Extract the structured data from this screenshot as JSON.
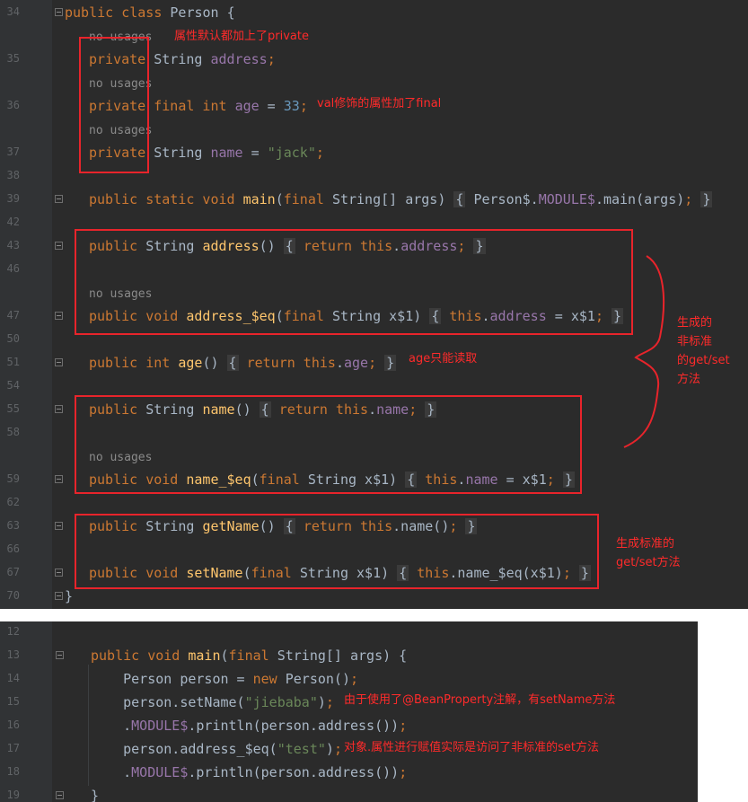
{
  "panel1": {
    "rows": [
      {
        "ln": "34",
        "fold": true,
        "parts": [
          {
            "t": "public class ",
            "c": "kw"
          },
          {
            "t": "Person {",
            "c": ""
          }
        ]
      },
      {
        "ln": "",
        "hint": "no usages"
      },
      {
        "ln": "35",
        "parts": [
          {
            "t": "private ",
            "c": "kw"
          },
          {
            "t": "String ",
            "c": ""
          },
          {
            "t": "address",
            "c": "fld"
          },
          {
            "t": ";",
            "c": "kw"
          }
        ]
      },
      {
        "ln": "",
        "hint": "no usages"
      },
      {
        "ln": "36",
        "parts": [
          {
            "t": "private final int ",
            "c": "kw"
          },
          {
            "t": "age",
            "c": "fld"
          },
          {
            "t": " = ",
            "c": ""
          },
          {
            "t": "33",
            "c": "num"
          },
          {
            "t": ";",
            "c": "kw"
          }
        ]
      },
      {
        "ln": "",
        "hint": "no usages"
      },
      {
        "ln": "37",
        "parts": [
          {
            "t": "private ",
            "c": "kw"
          },
          {
            "t": "String ",
            "c": ""
          },
          {
            "t": "name",
            "c": "fld"
          },
          {
            "t": " = ",
            "c": ""
          },
          {
            "t": "\"jack\"",
            "c": "str"
          },
          {
            "t": ";",
            "c": "kw"
          }
        ]
      },
      {
        "ln": "38",
        "parts": []
      },
      {
        "ln": "39",
        "fold": true,
        "parts": [
          {
            "t": "public static void ",
            "c": "kw"
          },
          {
            "t": "main",
            "c": "fn"
          },
          {
            "t": "(",
            "c": ""
          },
          {
            "t": "final ",
            "c": "kw"
          },
          {
            "t": "String[] args) ",
            "c": ""
          },
          {
            "t": "{",
            "c": "brace"
          },
          {
            "t": " Person$.",
            "c": ""
          },
          {
            "t": "MODULE$",
            "c": "fld"
          },
          {
            "t": ".main(args)",
            "c": ""
          },
          {
            "t": ";",
            "c": "kw"
          },
          {
            "t": " ",
            "c": ""
          },
          {
            "t": "}",
            "c": "brace"
          }
        ]
      },
      {
        "ln": "42",
        "parts": []
      },
      {
        "ln": "43",
        "fold": true,
        "parts": [
          {
            "t": "public ",
            "c": "kw"
          },
          {
            "t": "String ",
            "c": ""
          },
          {
            "t": "address",
            "c": "fn"
          },
          {
            "t": "() ",
            "c": ""
          },
          {
            "t": "{",
            "c": "brace"
          },
          {
            "t": " ",
            "c": ""
          },
          {
            "t": "return this",
            "c": "kw"
          },
          {
            "t": ".",
            "c": ""
          },
          {
            "t": "address",
            "c": "fld"
          },
          {
            "t": ";",
            "c": "kw"
          },
          {
            "t": " ",
            "c": ""
          },
          {
            "t": "}",
            "c": "brace"
          }
        ]
      },
      {
        "ln": "46",
        "parts": []
      },
      {
        "ln": "",
        "hint": "no usages"
      },
      {
        "ln": "47",
        "fold": true,
        "parts": [
          {
            "t": "public void ",
            "c": "kw"
          },
          {
            "t": "address_$eq",
            "c": "fn"
          },
          {
            "t": "(",
            "c": ""
          },
          {
            "t": "final ",
            "c": "kw"
          },
          {
            "t": "String x$1) ",
            "c": ""
          },
          {
            "t": "{",
            "c": "brace"
          },
          {
            "t": " ",
            "c": ""
          },
          {
            "t": "this",
            "c": "kw"
          },
          {
            "t": ".",
            "c": ""
          },
          {
            "t": "address",
            "c": "fld"
          },
          {
            "t": " = x$1",
            "c": ""
          },
          {
            "t": ";",
            "c": "kw"
          },
          {
            "t": " ",
            "c": ""
          },
          {
            "t": "}",
            "c": "brace"
          }
        ]
      },
      {
        "ln": "50",
        "parts": []
      },
      {
        "ln": "51",
        "fold": true,
        "parts": [
          {
            "t": "public int ",
            "c": "kw"
          },
          {
            "t": "age",
            "c": "fn"
          },
          {
            "t": "() ",
            "c": ""
          },
          {
            "t": "{",
            "c": "brace"
          },
          {
            "t": " ",
            "c": ""
          },
          {
            "t": "return this",
            "c": "kw"
          },
          {
            "t": ".",
            "c": ""
          },
          {
            "t": "age",
            "c": "fld"
          },
          {
            "t": ";",
            "c": "kw"
          },
          {
            "t": " ",
            "c": ""
          },
          {
            "t": "}",
            "c": "brace"
          }
        ]
      },
      {
        "ln": "54",
        "parts": []
      },
      {
        "ln": "55",
        "fold": true,
        "parts": [
          {
            "t": "public ",
            "c": "kw"
          },
          {
            "t": "String ",
            "c": ""
          },
          {
            "t": "name",
            "c": "fn"
          },
          {
            "t": "() ",
            "c": ""
          },
          {
            "t": "{",
            "c": "brace"
          },
          {
            "t": " ",
            "c": ""
          },
          {
            "t": "return this",
            "c": "kw"
          },
          {
            "t": ".",
            "c": ""
          },
          {
            "t": "name",
            "c": "fld"
          },
          {
            "t": ";",
            "c": "kw"
          },
          {
            "t": " ",
            "c": ""
          },
          {
            "t": "}",
            "c": "brace"
          }
        ]
      },
      {
        "ln": "58",
        "parts": []
      },
      {
        "ln": "",
        "hint": "no usages"
      },
      {
        "ln": "59",
        "fold": true,
        "parts": [
          {
            "t": "public void ",
            "c": "kw"
          },
          {
            "t": "name_$eq",
            "c": "fn"
          },
          {
            "t": "(",
            "c": ""
          },
          {
            "t": "final ",
            "c": "kw"
          },
          {
            "t": "String x$1) ",
            "c": ""
          },
          {
            "t": "{",
            "c": "brace"
          },
          {
            "t": " ",
            "c": ""
          },
          {
            "t": "this",
            "c": "kw"
          },
          {
            "t": ".",
            "c": ""
          },
          {
            "t": "name",
            "c": "fld"
          },
          {
            "t": " = x$1",
            "c": ""
          },
          {
            "t": ";",
            "c": "kw"
          },
          {
            "t": " ",
            "c": ""
          },
          {
            "t": "}",
            "c": "brace"
          }
        ]
      },
      {
        "ln": "62",
        "parts": []
      },
      {
        "ln": "63",
        "fold": true,
        "parts": [
          {
            "t": "public ",
            "c": "kw"
          },
          {
            "t": "String ",
            "c": ""
          },
          {
            "t": "getName",
            "c": "fn"
          },
          {
            "t": "() ",
            "c": ""
          },
          {
            "t": "{",
            "c": "brace"
          },
          {
            "t": " ",
            "c": ""
          },
          {
            "t": "return this",
            "c": "kw"
          },
          {
            "t": ".name()",
            "c": ""
          },
          {
            "t": ";",
            "c": "kw"
          },
          {
            "t": " ",
            "c": ""
          },
          {
            "t": "}",
            "c": "brace"
          }
        ]
      },
      {
        "ln": "66",
        "parts": []
      },
      {
        "ln": "67",
        "fold": true,
        "parts": [
          {
            "t": "public void ",
            "c": "kw"
          },
          {
            "t": "setName",
            "c": "fn"
          },
          {
            "t": "(",
            "c": ""
          },
          {
            "t": "final ",
            "c": "kw"
          },
          {
            "t": "String x$1) ",
            "c": ""
          },
          {
            "t": "{",
            "c": "brace"
          },
          {
            "t": " ",
            "c": ""
          },
          {
            "t": "this",
            "c": "kw"
          },
          {
            "t": ".name_$eq(x$1)",
            "c": ""
          },
          {
            "t": ";",
            "c": "kw"
          },
          {
            "t": " ",
            "c": ""
          },
          {
            "t": "}",
            "c": "brace"
          }
        ]
      },
      {
        "ln": "70",
        "fold": true,
        "parts": [
          {
            "t": "}",
            "c": ""
          }
        ]
      }
    ],
    "annotations": {
      "private_default": "属性默认都加上了private",
      "val_final": "val修饰的属性加了final",
      "age_readonly": "age只能读取",
      "nonstandard": "生成的\n非标准\n的get/set\n方法",
      "standard": "生成标准的\nget/set方法"
    }
  },
  "panel2": {
    "rows": [
      {
        "ln": "12",
        "parts": []
      },
      {
        "ln": "13",
        "fold": true,
        "parts": [
          {
            "t": "public void ",
            "c": "kw"
          },
          {
            "t": "main",
            "c": "fn"
          },
          {
            "t": "(",
            "c": ""
          },
          {
            "t": "final ",
            "c": "kw"
          },
          {
            "t": "String[] args) {",
            "c": ""
          }
        ]
      },
      {
        "ln": "14",
        "parts": [
          {
            "t": "    Person person = ",
            "c": ""
          },
          {
            "t": "new ",
            "c": "kw"
          },
          {
            "t": "Person()",
            "c": ""
          },
          {
            "t": ";",
            "c": "kw"
          }
        ]
      },
      {
        "ln": "15",
        "parts": [
          {
            "t": "    person.setName(",
            "c": ""
          },
          {
            "t": "\"jiebaba\"",
            "c": "str"
          },
          {
            "t": ")",
            "c": ""
          },
          {
            "t": ";",
            "c": "kw"
          }
        ]
      },
      {
        "ln": "16",
        "parts": [
          {
            "t": "    .",
            "c": ""
          },
          {
            "t": "MODULE$",
            "c": "fld"
          },
          {
            "t": ".println(person.address())",
            "c": ""
          },
          {
            "t": ";",
            "c": "kw"
          }
        ]
      },
      {
        "ln": "17",
        "parts": [
          {
            "t": "    person.address_$eq(",
            "c": ""
          },
          {
            "t": "\"test\"",
            "c": "str"
          },
          {
            "t": ")",
            "c": ""
          },
          {
            "t": ";",
            "c": "kw"
          }
        ]
      },
      {
        "ln": "18",
        "parts": [
          {
            "t": "    .",
            "c": ""
          },
          {
            "t": "MODULE$",
            "c": "fld"
          },
          {
            "t": ".println(person.address())",
            "c": ""
          },
          {
            "t": ";",
            "c": "kw"
          }
        ]
      },
      {
        "ln": "19",
        "fold": true,
        "parts": [
          {
            "t": "}",
            "c": ""
          }
        ]
      }
    ],
    "annotations": {
      "bean_property": "由于使用了@BeanProperty注解，有setName方法",
      "nonstandard_set": "对象.属性进行赋值实际是访问了非标准的set方法"
    }
  }
}
